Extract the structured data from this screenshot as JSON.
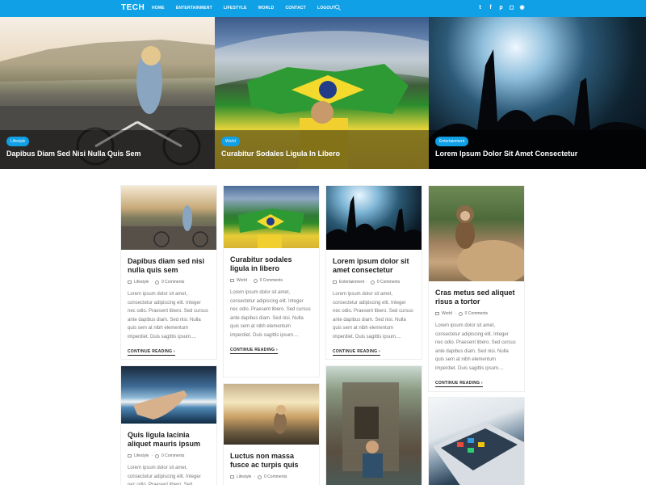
{
  "nav": {
    "logo": "TECH",
    "menu": [
      "HOME",
      "ENTERTAINMENT",
      "LIFESTYLE",
      "WORLD",
      "CONTACT",
      "LOGOUT"
    ],
    "social": [
      "twitter-icon",
      "facebook-icon",
      "pinterest-icon",
      "instagram-icon",
      "rss-icon"
    ],
    "accent": "#10a0e6"
  },
  "hero": [
    {
      "tag": "Lifestyle",
      "caption": "Dapibus Diam Sed Nisi Nulla Quis Sem"
    },
    {
      "tag": "World",
      "caption": "Curabitur Sodales Ligula In Libero"
    },
    {
      "tag": "Entertainment",
      "caption": "Lorem Ipsum Dolor Sit Amet Consectetur"
    }
  ],
  "cards": [
    {
      "title": "Dapibus diam sed nisi nulla quis sem",
      "category": "Lifestyle",
      "comments": "0 Comments",
      "excerpt": "Lorem ipsum dolor sit amet, consectetur adipiscing elit. Integer nec odio. Praesent libero. Sed cursus ante dapibus diam. Sed nisi. Nulla quis sem at nibh elementum imperdiet. Duis sagittis ipsum....",
      "more": "CONTINUE READING"
    },
    {
      "title": "Curabitur sodales ligula in libero",
      "category": "World",
      "comments": "0 Comments",
      "excerpt": "Lorem ipsum dolor sit amet, consectetur adipiscing elit. Integer nec odio. Praesent libero. Sed cursus ante dapibus diam. Sed nisi. Nulla quis sem at nibh elementum imperdiet. Duis sagittis ipsum....",
      "more": "CONTINUE READING"
    },
    {
      "title": "Lorem ipsum dolor sit amet consectetur",
      "category": "Entertainment",
      "comments": "0 Comments",
      "excerpt": "Lorem ipsum dolor sit amet, consectetur adipiscing elit. Integer nec odio. Praesent libero. Sed cursus ante dapibus diam. Sed nisi. Nulla quis sem at nibh elementum imperdiet. Duis sagittis ipsum....",
      "more": "CONTINUE READING"
    },
    {
      "title": "Cras metus sed aliquet risus a tortor",
      "category": "World",
      "comments": "0 Comments",
      "excerpt": "Lorem ipsum dolor sit amet, consectetur adipiscing elit. Integer nec odio. Praesent libero. Sed cursus ante dapibus diam. Sed nisi. Nulla quis sem at nibh elementum imperdiet. Duis sagittis ipsum....",
      "more": "CONTINUE READING"
    },
    {
      "title": "Quis ligula lacinia aliquet mauris ipsum",
      "category": "Lifestyle",
      "comments": "0 Comments",
      "excerpt": "Lorem ipsum dolor sit amet, consectetur adipiscing elit. Integer nec odio. Praesent libero. Sed",
      "more": ""
    },
    {
      "title": "Luctus non massa fusce ac turpis quis",
      "category": "Lifestyle",
      "comments": "0 Comments",
      "excerpt": "",
      "more": ""
    },
    {
      "title": "",
      "category": "",
      "comments": "",
      "excerpt": "",
      "more": ""
    },
    {
      "title": "",
      "category": "",
      "comments": "",
      "excerpt": "",
      "more": ""
    }
  ]
}
